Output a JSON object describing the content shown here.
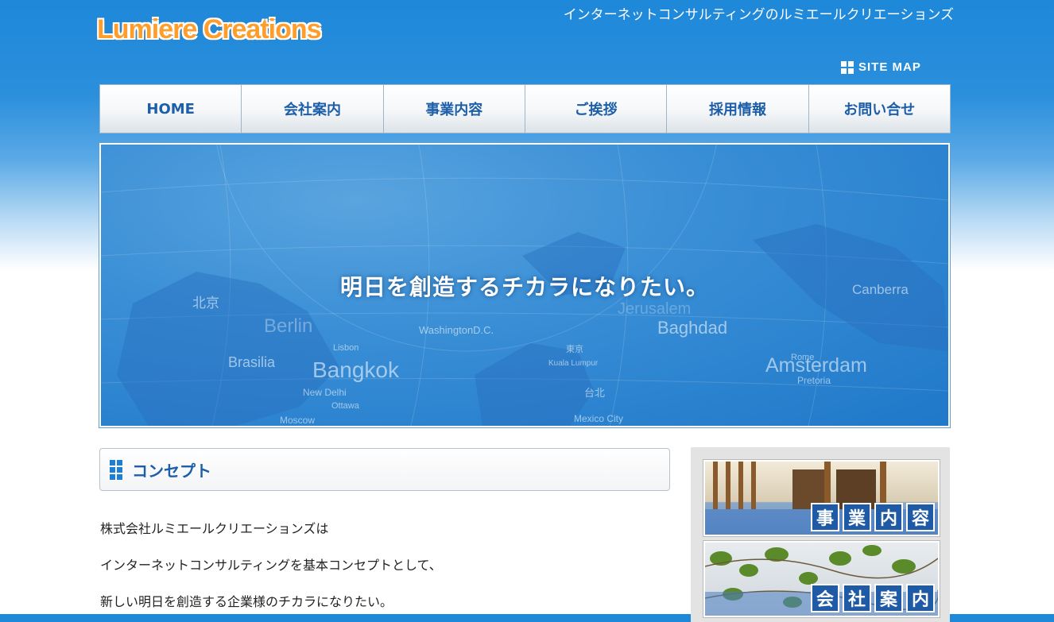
{
  "header": {
    "logo_text": "Lumiere Creations",
    "tagline": "インターネットコンサルティングのルミエールクリエーションズ",
    "sitemap_label": "SITE MAP"
  },
  "nav": {
    "items": [
      {
        "label": "HOME"
      },
      {
        "label": "会社案内"
      },
      {
        "label": "事業内容"
      },
      {
        "label": "ご挨拶"
      },
      {
        "label": "採用情報"
      },
      {
        "label": "お問い合せ"
      }
    ]
  },
  "hero": {
    "main_text": "明日を創造するチカラになりたい。",
    "city_labels": [
      "北京",
      "Berlin",
      "Lisbon",
      "Bangkok",
      "New Delhi",
      "Ottawa",
      "Moscow",
      "WashingtonD.C.",
      "東京",
      "Kuala Lumpur",
      "台北",
      "Mexico City",
      "Jerusalem",
      "Baghdad",
      "Canberra",
      "Rome",
      "Amsterdam",
      "Pretoria",
      "Brasilia"
    ]
  },
  "concept": {
    "title": "コンセプト",
    "paragraphs": [
      "株式会社ルミエールクリエーションズは",
      "インターネットコンサルティングを基本コンセプトとして、",
      "新しい明日を創造する企業様のチカラになりたい。"
    ]
  },
  "side": {
    "banner1_chars": [
      "事",
      "業",
      "内",
      "容"
    ],
    "banner2_chars": [
      "会",
      "社",
      "案",
      "内"
    ]
  }
}
